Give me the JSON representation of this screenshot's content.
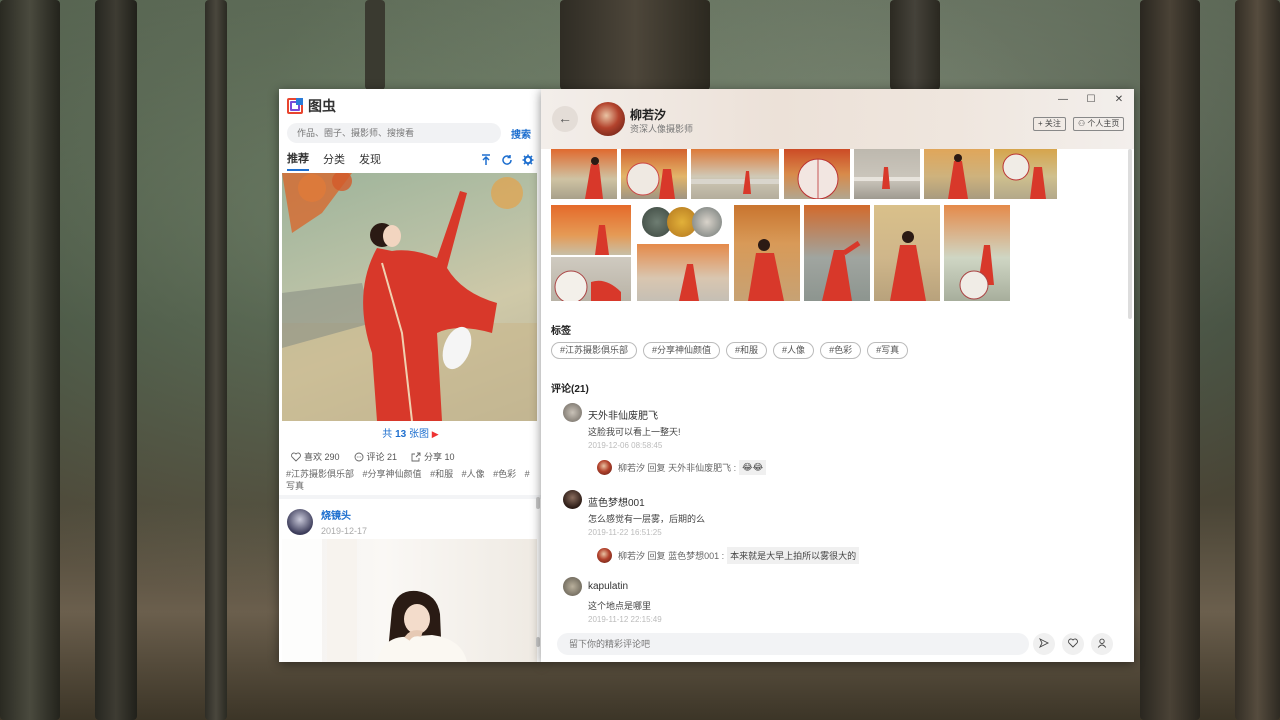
{
  "left_panel": {
    "app_name": "图虫",
    "search_placeholder": "作品、圈子、摄影师、搜搜看",
    "search_label": "搜索",
    "nav_tabs": [
      "推荐",
      "分类",
      "发现"
    ],
    "post": {
      "count_prefix": "共",
      "count_number": "13",
      "count_suffix": "张图",
      "likes": "喜欢 290",
      "comments": "评论 21",
      "shares": "分享 10",
      "tags": [
        "#江苏摄影俱乐部",
        "#分享神仙颜值",
        "#和服",
        "#人像",
        "#色彩",
        "#写真"
      ]
    },
    "next_post": {
      "author": "烧镜头",
      "date": "2019-12-17"
    }
  },
  "right_panel": {
    "user_name": "柳若汐",
    "user_title": "资深人像摄影师",
    "follow_label": "+ 关注",
    "home_label": "个人主页",
    "window_controls": {
      "minimize": "—",
      "maximize": "☐",
      "close": "✕"
    },
    "tags_heading": "标签",
    "tags": [
      "#江苏摄影俱乐部",
      "#分享神仙颜值",
      "#和服",
      "#人像",
      "#色彩",
      "#写真"
    ],
    "comments_heading": "评论(21)",
    "comments": [
      {
        "name": "天外非仙废肥飞",
        "text": "这脸我可以看上一整天!",
        "time": "2019-12-06 08:58:45",
        "reply_author": "柳若汐",
        "reply_word": "回复",
        "reply_to": "天外非仙废肥飞 :",
        "reply_text": "😂😂"
      },
      {
        "name": "蓝色梦想001",
        "text": "怎么感觉有一层雾，后期的么",
        "time": "2019-11-22 16:51:25",
        "reply_author": "柳若汐",
        "reply_word": "回复",
        "reply_to": "蓝色梦想001 :",
        "reply_text": "本来就是大早上拍所以雾很大的"
      },
      {
        "name": "kapulatin",
        "text": "这个地点是哪里",
        "time": "2019-11-12 22:15:49"
      }
    ],
    "comment_placeholder": "留下你的精彩评论吧"
  },
  "icons": {
    "back": "arrow-left-icon",
    "send": "send-icon",
    "like": "heart-icon",
    "profile": "user-icon"
  },
  "colors": {
    "accent": "#1e6fcf",
    "dress": "#d8382a"
  }
}
